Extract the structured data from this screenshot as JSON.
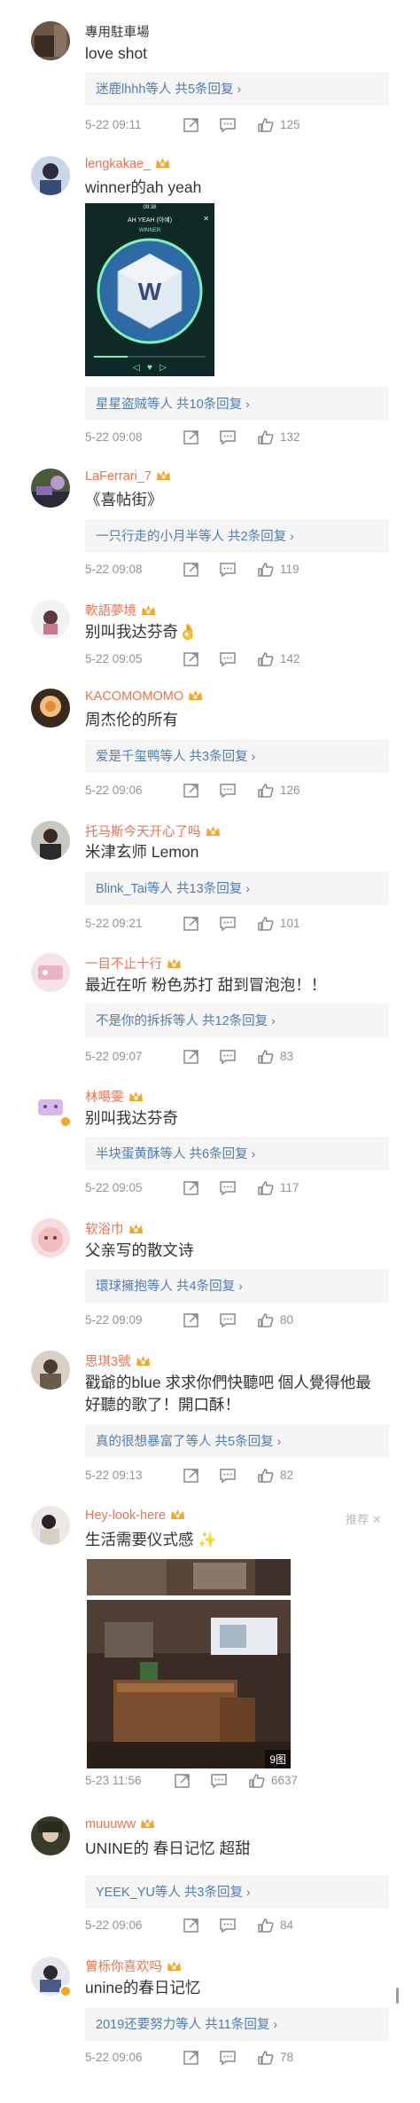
{
  "comments": [
    {
      "username": "專用駐車場",
      "name_style": "plain",
      "crown": false,
      "verified": false,
      "text": "love shot",
      "reply_who": "迷鹿lhhh",
      "reply_more": "等人 共5条回复",
      "time": "5-22 09:11",
      "likes": "125"
    },
    {
      "username": "lengkakae_",
      "name_style": "orange",
      "crown": true,
      "verified": false,
      "text": "winner的ah yeah",
      "image": {
        "kind": "phone-screenshot",
        "status_time": "09:38",
        "song_title": "AH YEAH (아예)",
        "artist": "WINNER"
      },
      "reply_who": "星星盗贼",
      "reply_more": "等人 共10条回复",
      "time": "5-22 09:08",
      "likes": "132"
    },
    {
      "username": "LaFerrari_7",
      "name_style": "orange",
      "crown": true,
      "verified": false,
      "text": "《喜帖街》",
      "reply_who": "一只行走的小月半",
      "reply_more": "等人 共2条回复",
      "time": "5-22 09:08",
      "likes": "119"
    },
    {
      "username": "軟語夢境",
      "name_style": "orange",
      "crown": true,
      "verified": false,
      "text": "别叫我达芬奇👌",
      "time": "5-22 09:05",
      "likes": "142"
    },
    {
      "username": "KACOMOMOMO",
      "name_style": "orange",
      "crown": true,
      "verified": false,
      "text": "周杰伦的所有",
      "reply_who": "爱是千玺鸭",
      "reply_more": "等人 共3条回复",
      "time": "5-22 09:06",
      "likes": "126"
    },
    {
      "username": "托马斯今天开心了吗",
      "name_style": "orange",
      "crown": true,
      "verified": false,
      "text": "米津玄师 Lemon",
      "reply_who": "Blink_Tai",
      "reply_more": "等人 共13条回复",
      "time": "5-22 09:21",
      "likes": "101"
    },
    {
      "username": "一目不止十行",
      "name_style": "orange",
      "crown": true,
      "verified": false,
      "text": "最近在听 粉色苏打 甜到冒泡泡！！",
      "reply_who": "不是你的拆拆",
      "reply_more": "等人 共12条回复",
      "time": "5-22 09:07",
      "likes": "83"
    },
    {
      "username": "林噶雯",
      "name_style": "orange",
      "crown": true,
      "verified": true,
      "text": "别叫我达芬奇",
      "reply_who": "半块蛋黄酥",
      "reply_more": "等人 共6条回复",
      "time": "5-22 09:05",
      "likes": "117"
    },
    {
      "username": "软浴巾",
      "name_style": "orange",
      "crown": true,
      "verified": false,
      "text": "父亲写的散文诗",
      "reply_who": "環球擁抱",
      "reply_more": "等人 共4条回复",
      "time": "5-22 09:09",
      "likes": "80"
    },
    {
      "username": "思琪3號",
      "name_style": "orange",
      "crown": true,
      "verified": false,
      "text": "戳爺的blue 求求你們快聽吧 個人覺得他最",
      "text2": "好聽的歌了！開口酥！",
      "reply_who": "真的很想暴富了",
      "reply_more": "等人 共5条回复",
      "time": "5-22 09:13",
      "likes": "82"
    },
    {
      "username": "Hey-look-here",
      "name_style": "orange",
      "crown": true,
      "verified": false,
      "recommend": "推荐 ✕",
      "text": "生活需要仪式感 ✨",
      "image_badge": "9图",
      "time": "5-23 11:56",
      "likes": "6637"
    },
    {
      "username": "muuuww",
      "name_style": "orange",
      "crown": true,
      "verified": false,
      "text": "UNINE的 春日记忆 超甜",
      "reply_who": "YEEK_YU",
      "reply_more": "等人 共3条回复",
      "time": "5-22 09:06",
      "likes": "84"
    },
    {
      "username": "曾栎你喜欢吗",
      "name_style": "orange",
      "crown": true,
      "verified": true,
      "text": "unine的春日记忆",
      "reply_who": "2019还要努力",
      "reply_more": "等人 共11条回复",
      "time": "5-22 09:06",
      "likes": "78"
    }
  ],
  "colors": {
    "username": "#eb7350",
    "link": "#507daf",
    "meta": "#939393",
    "reply_bg": "#f5f5f5",
    "crown": "#f5a623"
  },
  "icons": [
    "share-icon",
    "comment-icon",
    "like-icon",
    "crown-icon",
    "chevron-right-icon",
    "close-icon"
  ]
}
